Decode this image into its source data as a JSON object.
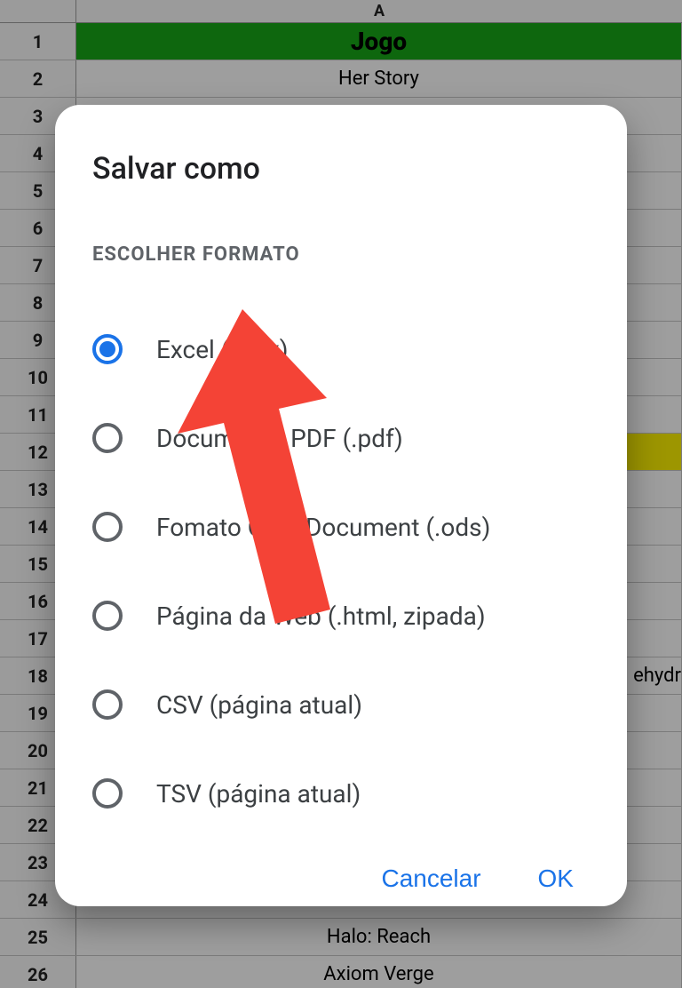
{
  "sheet": {
    "column_label": "A",
    "rows": [
      {
        "n": "1",
        "value": "Jogo",
        "variant": "title"
      },
      {
        "n": "2",
        "value": "Her Story",
        "variant": ""
      },
      {
        "n": "3",
        "value": "",
        "variant": ""
      },
      {
        "n": "4",
        "value": "",
        "variant": ""
      },
      {
        "n": "5",
        "value": "",
        "variant": ""
      },
      {
        "n": "6",
        "value": "",
        "variant": ""
      },
      {
        "n": "7",
        "value": "",
        "variant": ""
      },
      {
        "n": "8",
        "value": "",
        "variant": ""
      },
      {
        "n": "9",
        "value": "",
        "variant": ""
      },
      {
        "n": "10",
        "value": "",
        "variant": ""
      },
      {
        "n": "11",
        "value": "",
        "variant": ""
      },
      {
        "n": "12",
        "value": "",
        "variant": "yellow"
      },
      {
        "n": "13",
        "value": "",
        "variant": ""
      },
      {
        "n": "14",
        "value": "",
        "variant": ""
      },
      {
        "n": "15",
        "value": "",
        "variant": ""
      },
      {
        "n": "16",
        "value": "",
        "variant": ""
      },
      {
        "n": "17",
        "value": "",
        "variant": ""
      },
      {
        "n": "18",
        "value": "ehydr",
        "variant": ""
      },
      {
        "n": "19",
        "value": "",
        "variant": ""
      },
      {
        "n": "20",
        "value": "",
        "variant": ""
      },
      {
        "n": "21",
        "value": "",
        "variant": ""
      },
      {
        "n": "22",
        "value": "",
        "variant": ""
      },
      {
        "n": "23",
        "value": "",
        "variant": ""
      },
      {
        "n": "24",
        "value": "",
        "variant": ""
      },
      {
        "n": "25",
        "value": "Halo: Reach",
        "variant": ""
      },
      {
        "n": "26",
        "value": "Axiom Verge",
        "variant": ""
      }
    ]
  },
  "dialog": {
    "title": "Salvar como",
    "section_label": "ESCOLHER FORMATO",
    "options": [
      {
        "label": "Excel (.xlsx)",
        "selected": true
      },
      {
        "label": "Documento PDF (.pdf)",
        "selected": false
      },
      {
        "label": "Fomato OpenDocument (.ods)",
        "selected": false
      },
      {
        "label": "Página da Web (.html, zipada)",
        "selected": false
      },
      {
        "label": "CSV (página atual)",
        "selected": false
      },
      {
        "label": "TSV (página atual)",
        "selected": false
      }
    ],
    "cancel_label": "Cancelar",
    "ok_label": "OK"
  },
  "colors": {
    "accent": "#1a73e8",
    "header_green": "#18a718",
    "highlight_yellow": "#fef200",
    "annotation_red": "#f44336"
  }
}
